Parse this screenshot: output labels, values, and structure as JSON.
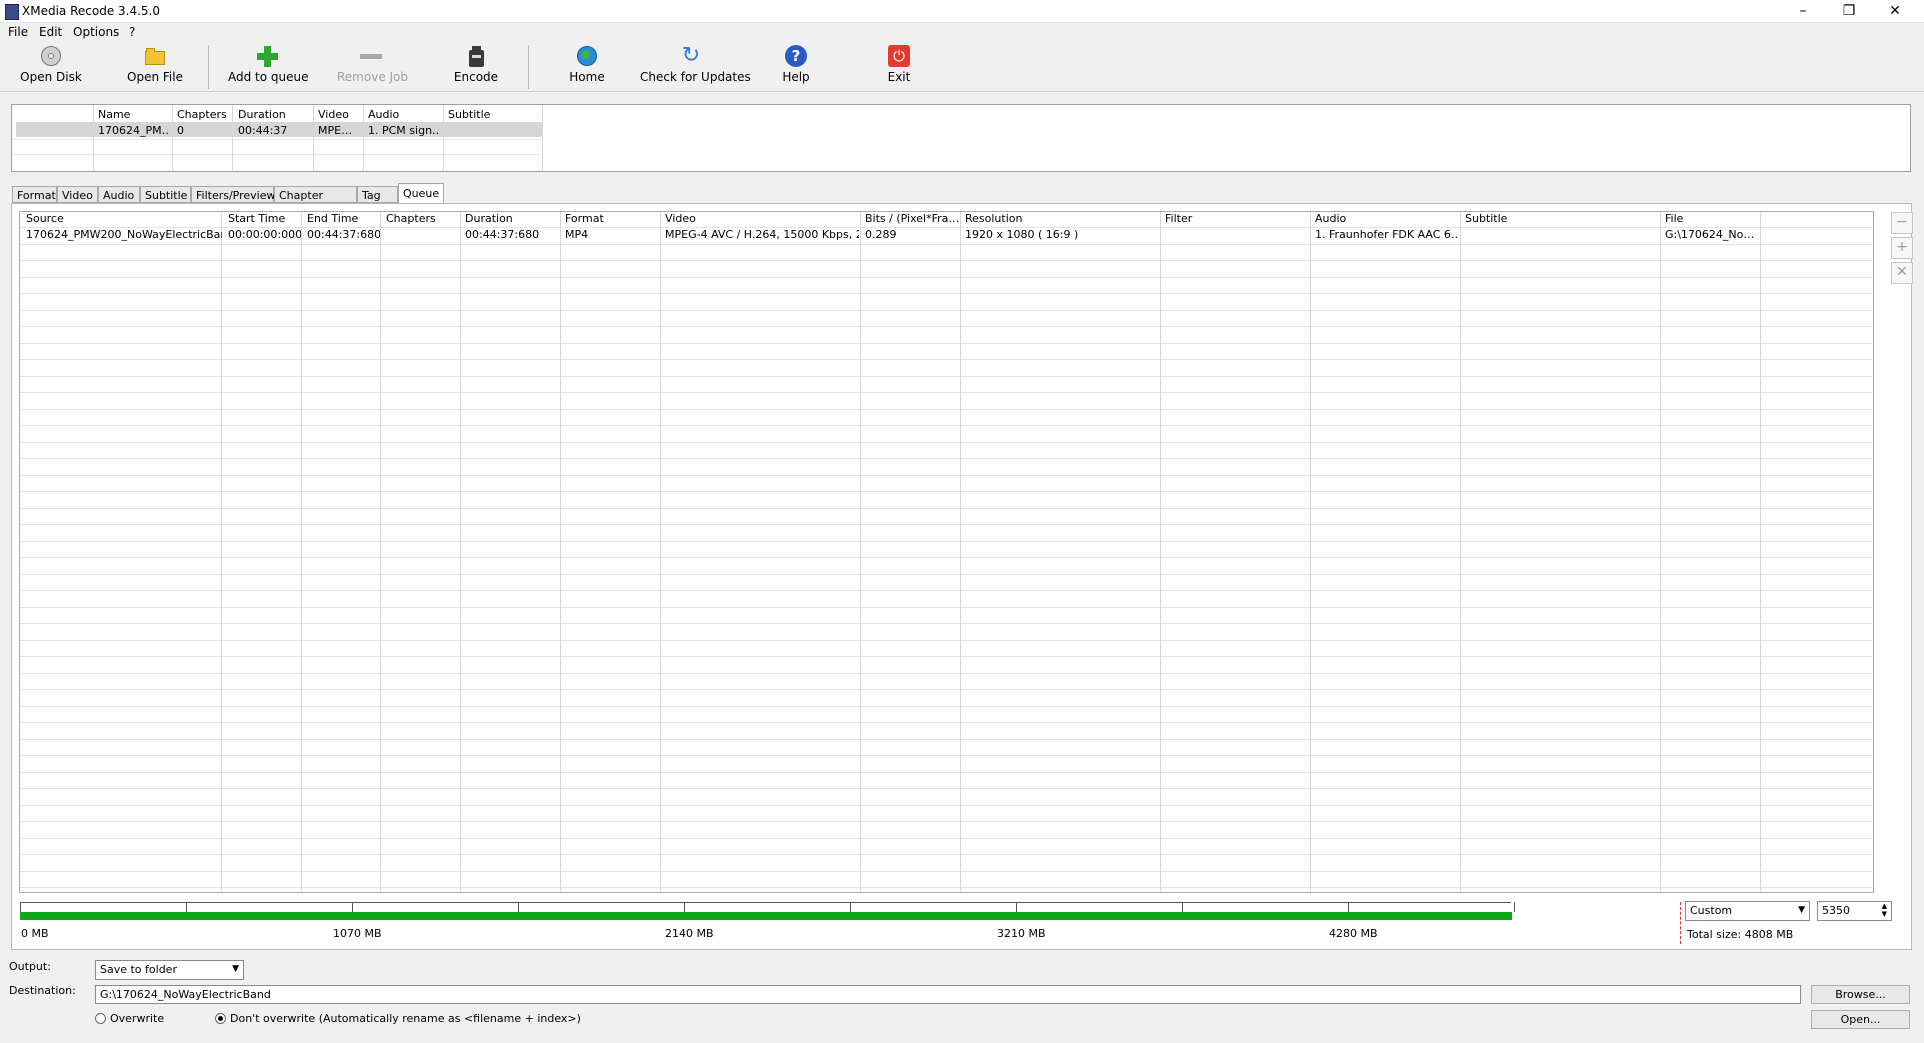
{
  "window": {
    "title": "XMedia Recode 3.4.5.0",
    "min_glyph": "–",
    "max_glyph": "❐",
    "close_glyph": "✕"
  },
  "menu": [
    "File",
    "Edit",
    "Options",
    "?"
  ],
  "toolbar": {
    "open_disk": "Open Disk",
    "open_file": "Open File",
    "add_to_queue": "Add to queue",
    "remove_job": "Remove Job",
    "encode": "Encode",
    "home": "Home",
    "check_updates": "Check for Updates",
    "help": "Help",
    "exit": "Exit"
  },
  "source_table": {
    "columns": [
      "Name",
      "Chapters",
      "Duration",
      "Video",
      "Audio",
      "Subtitle"
    ],
    "rows": [
      [
        "170624_PM…",
        "0",
        "00:44:37",
        "MPE…",
        "1. PCM sign…",
        ""
      ]
    ]
  },
  "tabs": [
    "Format",
    "Video",
    "Audio",
    "Subtitle",
    "Filters/Preview",
    "Chapter Editor",
    "Tag",
    "Queue"
  ],
  "active_tab": "Queue",
  "queue": {
    "columns": [
      "Source",
      "Start Time",
      "End Time",
      "Chapters",
      "Duration",
      "Format",
      "Video",
      "Bits / (Pixel*Fra…",
      "Resolution",
      "Filter",
      "Audio",
      "Subtitle",
      "File"
    ],
    "rows": [
      [
        "170624_PMW200_NoWayElectricBan…",
        "00:00:00:000",
        "00:44:37:680",
        "",
        "00:44:37:680",
        "MP4",
        "MPEG-4 AVC / H.264, 15000 Kbps, 2…",
        "0.289",
        "1920 x 1080 ( 16:9 )",
        "",
        "1. Fraunhofer FDK AAC 6…",
        "",
        "G:\\170624_No…"
      ]
    ],
    "side_buttons": {
      "minus": "−",
      "plus": "+",
      "close": "✕"
    }
  },
  "size_bar": {
    "labels": [
      "0 MB",
      "1070 MB",
      "2140 MB",
      "3210 MB",
      "4280 MB"
    ],
    "fill_mb": 4808,
    "limit_mb": 5350,
    "fill_color": "#0fa81a",
    "preset": "Custom",
    "target_value": "5350",
    "total_size": "Total size: 4808 MB"
  },
  "output": {
    "output_label": "Output:",
    "output_value": "Save to folder",
    "destination_label": "Destination:",
    "destination_value": "G:\\170624_NoWayElectricBand",
    "browse": "Browse...",
    "open": "Open...",
    "overwrite": "Overwrite",
    "dont_overwrite": "Don't overwrite (Automatically rename as <filename + index>)"
  }
}
